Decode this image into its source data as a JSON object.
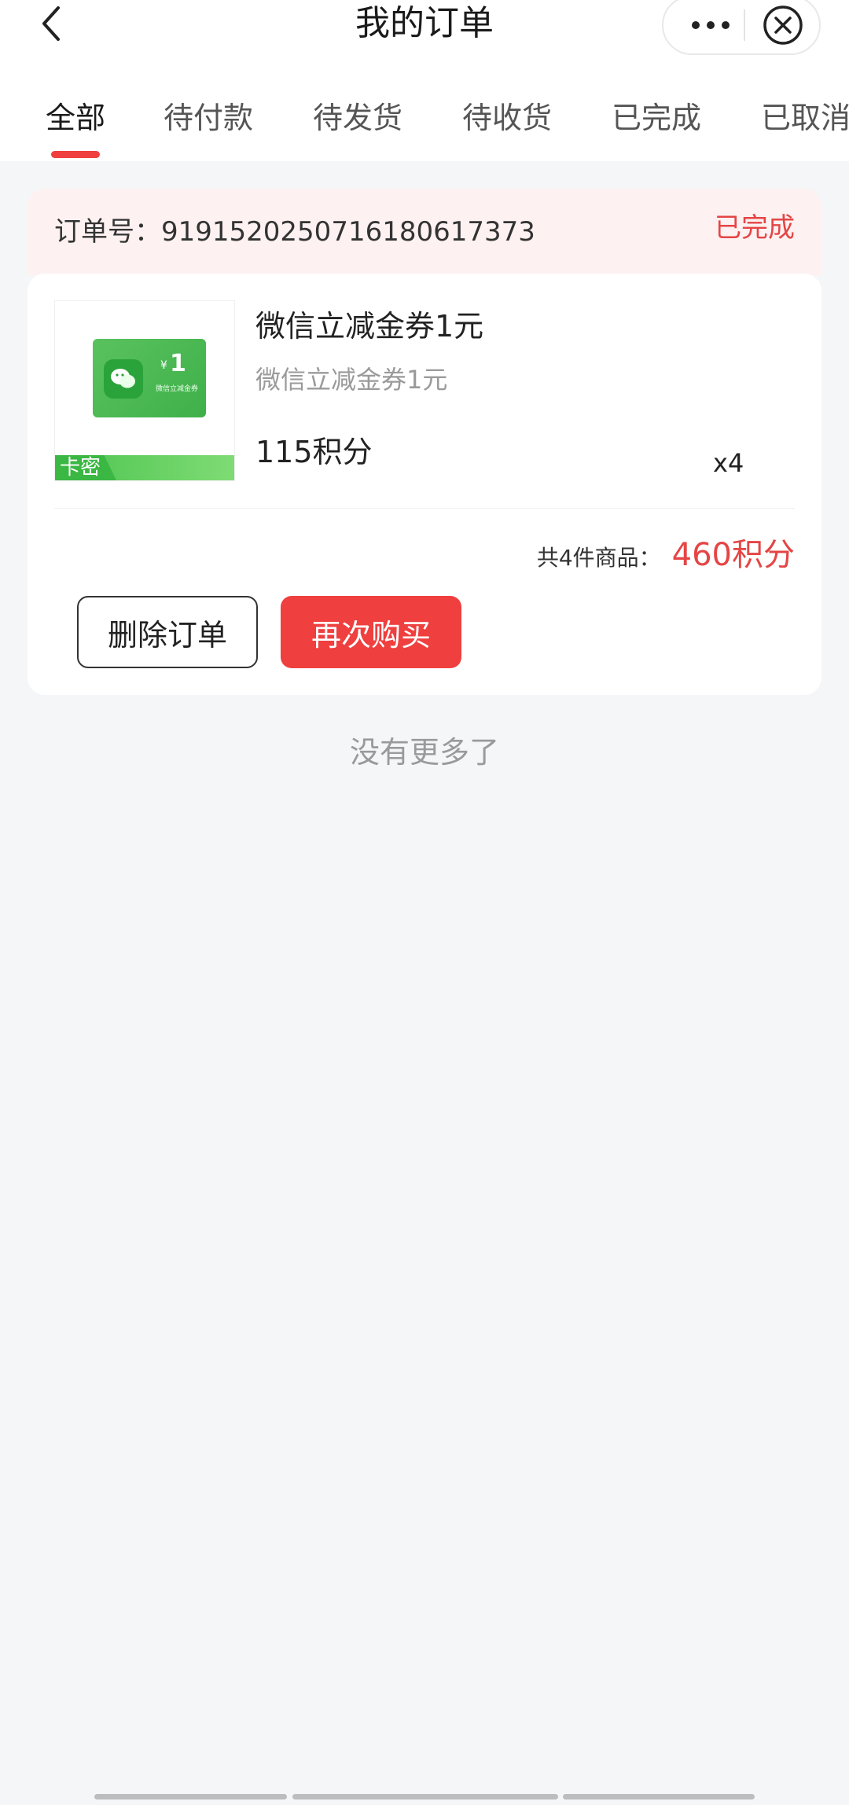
{
  "header": {
    "title": "我的订单",
    "back_icon": "chevron-left-icon",
    "more_icon": "more-dots-icon",
    "close_icon": "close-circle-icon"
  },
  "tabs": [
    {
      "label": "全部",
      "active": true
    },
    {
      "label": "待付款",
      "active": false
    },
    {
      "label": "待发货",
      "active": false
    },
    {
      "label": "待收货",
      "active": false
    },
    {
      "label": "已完成",
      "active": false
    },
    {
      "label": "已取消",
      "active": false
    }
  ],
  "order": {
    "number_label": "订单号：",
    "number": "919152025071618061737 3",
    "status": "已完成",
    "item": {
      "title": "微信立减金券1元",
      "subtitle": "微信立减金券1元",
      "price": "115积分",
      "quantity": "x4",
      "thumb": {
        "yen": "¥",
        "value": "1",
        "caption": "微信立减金券",
        "tag": "卡密"
      }
    },
    "summary_label": "共4件商品：",
    "summary_total": "460积分",
    "buttons": {
      "delete": "删除订单",
      "rebuy": "再次购买"
    }
  },
  "footer": {
    "no_more": "没有更多了"
  },
  "colors": {
    "accent": "#ef3f3f",
    "status_red": "#e54545",
    "header_bg": "#fdf1f1",
    "page_bg": "#f5f6f8"
  }
}
